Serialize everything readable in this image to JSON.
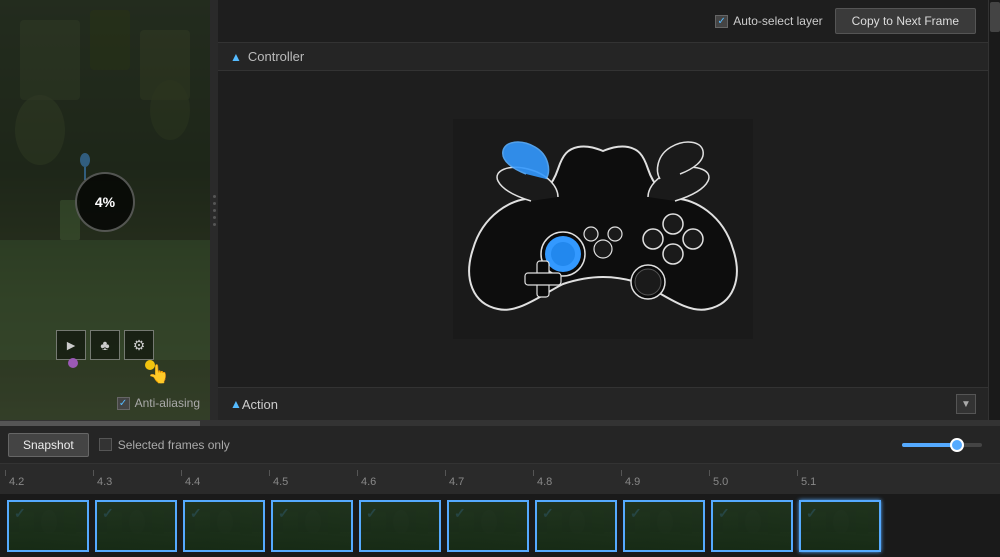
{
  "header": {
    "auto_select_label": "Auto-select layer",
    "copy_next_label": "Copy to Next Frame"
  },
  "controller_section": {
    "label": "Controller"
  },
  "action_section": {
    "label": "Action"
  },
  "bottom_bar": {
    "snapshot_label": "Snapshot",
    "selected_frames_label": "Selected frames only",
    "anti_aliasing_label": "Anti-aliasing"
  },
  "percentage": {
    "value": "4%"
  },
  "timeline": {
    "marks": [
      "4.2",
      "4.3",
      "4.4",
      "4.5",
      "4.6",
      "4.7",
      "4.8",
      "4.9",
      "5.0",
      "5.1"
    ],
    "frames": [
      {
        "label": "4.2",
        "selected": true,
        "active": false
      },
      {
        "label": "4.3",
        "selected": true,
        "active": false
      },
      {
        "label": "4.4",
        "selected": true,
        "active": false
      },
      {
        "label": "4.5",
        "selected": true,
        "active": false
      },
      {
        "label": "4.6",
        "selected": true,
        "active": false
      },
      {
        "label": "4.7",
        "selected": true,
        "active": false
      },
      {
        "label": "4.8",
        "selected": true,
        "active": false
      },
      {
        "label": "4.9",
        "selected": true,
        "active": false
      },
      {
        "label": "5.0",
        "selected": true,
        "active": false
      },
      {
        "label": "5.1",
        "selected": true,
        "active": true
      }
    ]
  },
  "icons": {
    "checkbox_checked": "✓",
    "arrow_up": "▲",
    "dropdown_arrow": "▼",
    "cursor": "👆",
    "tree": "♣",
    "gear": "⚙",
    "bullet": "●"
  },
  "colors": {
    "accent": "#5aafff",
    "background_dark": "#1a1a1a",
    "background_mid": "#1e1e1e",
    "panel_bg": "#252525",
    "border": "#333333",
    "text_primary": "#cccccc",
    "text_dim": "#888888",
    "controller_fill": "#0a0a0a",
    "controller_stroke": "#ffffff",
    "controller_accent": "#5aafff"
  }
}
